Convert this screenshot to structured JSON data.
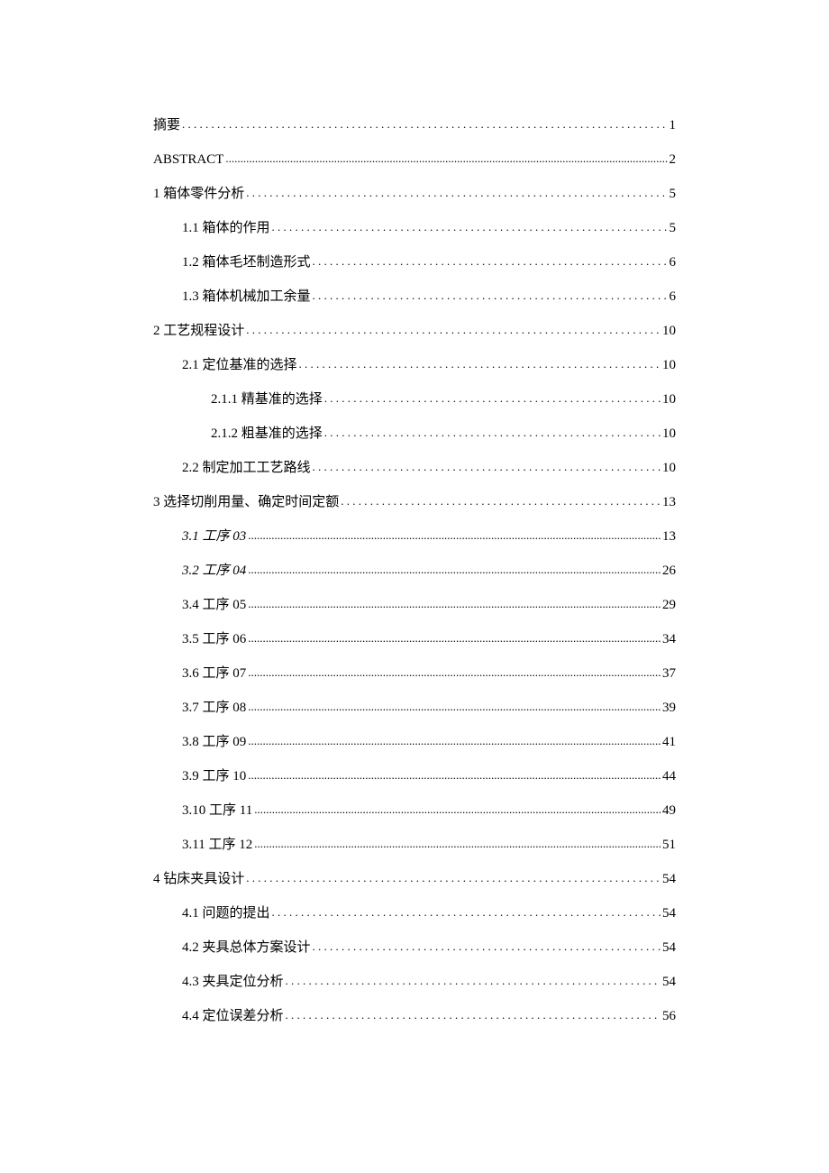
{
  "toc": [
    {
      "level": 1,
      "title": "摘要",
      "page": "1",
      "italic": false,
      "dotstyle": "sparse"
    },
    {
      "level": 1,
      "title": "ABSTRACT",
      "page": "2",
      "italic": false,
      "dotstyle": "dense"
    },
    {
      "level": 1,
      "title": "1 箱体零件分析",
      "page": "5",
      "italic": false,
      "dotstyle": "sparse",
      "gap": "num"
    },
    {
      "level": 2,
      "title": "1.1  箱体的作用",
      "page": "5",
      "italic": false,
      "dotstyle": "sparse"
    },
    {
      "level": 2,
      "title": "1.2  箱体毛坯制造形式",
      "page": "6",
      "italic": false,
      "dotstyle": "sparse"
    },
    {
      "level": 2,
      "title": "1.3  箱体机械加工余量",
      "page": "6",
      "italic": false,
      "dotstyle": "sparse"
    },
    {
      "level": 1,
      "title": "2 工艺规程设计",
      "page": "10",
      "italic": false,
      "dotstyle": "sparse",
      "gap": "num"
    },
    {
      "level": 2,
      "title": "2.1  定位基准的选择",
      "page": "10",
      "italic": false,
      "dotstyle": "sparse"
    },
    {
      "level": 3,
      "title": "2.1.1  精基准的选择",
      "page": "10",
      "italic": false,
      "dotstyle": "sparse"
    },
    {
      "level": 3,
      "title": "2.1.2  粗基准的选择",
      "page": "10",
      "italic": false,
      "dotstyle": "sparse"
    },
    {
      "level": 2,
      "title": "2.2  制定加工工艺路线",
      "page": "10",
      "italic": false,
      "dotstyle": "sparse"
    },
    {
      "level": 1,
      "title": "3 选择切削用量、确定时间定额",
      "page": "13",
      "italic": false,
      "dotstyle": "sparse",
      "gap": "num"
    },
    {
      "level": 2,
      "title": "3.1  工序 03",
      "page": "13",
      "italic": true,
      "dotstyle": "dense"
    },
    {
      "level": 2,
      "title": "3.2  工序 04",
      "page": "26",
      "italic": true,
      "dotstyle": "dense"
    },
    {
      "level": 2,
      "title": "3.4  工序 05",
      "page": "29",
      "italic": false,
      "dotstyle": "dense"
    },
    {
      "level": 2,
      "title": "3.5  工序 06",
      "page": "34",
      "italic": false,
      "dotstyle": "dense"
    },
    {
      "level": 2,
      "title": "3.6  工序 07",
      "page": "37",
      "italic": false,
      "dotstyle": "dense"
    },
    {
      "level": 2,
      "title": "3.7  工序 08",
      "page": "39",
      "italic": false,
      "dotstyle": "dense"
    },
    {
      "level": 2,
      "title": "3.8  工序 09",
      "page": "41",
      "italic": false,
      "dotstyle": "dense"
    },
    {
      "level": 2,
      "title": "3.9  工序 10",
      "page": "44",
      "italic": false,
      "dotstyle": "dense"
    },
    {
      "level": 2,
      "title": "3.10 工序 11",
      "page": "49",
      "italic": false,
      "dotstyle": "dense"
    },
    {
      "level": 2,
      "title": "3.11   工序 12",
      "page": "51",
      "italic": false,
      "dotstyle": "dense"
    },
    {
      "level": 1,
      "title": "4 钻床夹具设计",
      "page": "54",
      "italic": false,
      "dotstyle": "sparse",
      "gap": "num"
    },
    {
      "level": 2,
      "title": "4.1  问题的提出",
      "page": "54",
      "italic": false,
      "dotstyle": "sparse"
    },
    {
      "level": 2,
      "title": "4.2  夹具总体方案设计",
      "page": "54",
      "italic": false,
      "dotstyle": "sparse"
    },
    {
      "level": 2,
      "title": "4.3  夹具定位分析",
      "page": "54",
      "italic": false,
      "dotstyle": "sparse"
    },
    {
      "level": 2,
      "title": "4.4   定位误差分析",
      "page": "56",
      "italic": false,
      "dotstyle": "sparse"
    }
  ]
}
